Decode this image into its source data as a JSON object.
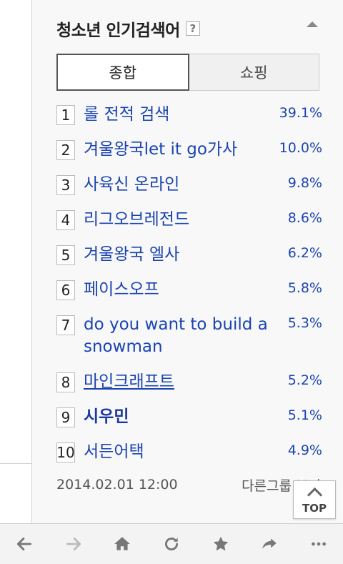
{
  "widget": {
    "title": "청소년 인기검색어",
    "help_symbol": "?",
    "tabs": [
      {
        "label": "종합",
        "active": true
      },
      {
        "label": "쇼핑",
        "active": false
      }
    ]
  },
  "rankings": [
    {
      "rank": "1",
      "term": "롤 전적 검색",
      "percent": "39.1%"
    },
    {
      "rank": "2",
      "term": "겨울왕국let it go가사",
      "percent": "10.0%"
    },
    {
      "rank": "3",
      "term": "사육신 온라인",
      "percent": "9.8%"
    },
    {
      "rank": "4",
      "term": "리그오브레전드",
      "percent": "8.6%"
    },
    {
      "rank": "5",
      "term": "겨울왕국 엘사",
      "percent": "6.2%"
    },
    {
      "rank": "6",
      "term": "페이스오프",
      "percent": "5.8%"
    },
    {
      "rank": "7",
      "term": "do you want to build a snowman",
      "percent": "5.3%"
    },
    {
      "rank": "8",
      "term": "마인크래프트",
      "percent": "5.2%"
    },
    {
      "rank": "9",
      "term": "시우민",
      "percent": "5.1%"
    },
    {
      "rank": "10",
      "term": "서든어택",
      "percent": "4.9%"
    }
  ],
  "footer": {
    "timestamp": "2014.02.01 12:00",
    "more_label": "다른그룹 보기"
  },
  "top_button": {
    "label": "TOP"
  },
  "toolbar": {
    "icons": [
      "back-arrow-icon",
      "forward-arrow-icon",
      "home-icon",
      "refresh-icon",
      "star-icon",
      "share-icon",
      "more-icon"
    ]
  },
  "colors": {
    "link": "#1a44b0",
    "panel_bg": "#f8f8f8"
  }
}
